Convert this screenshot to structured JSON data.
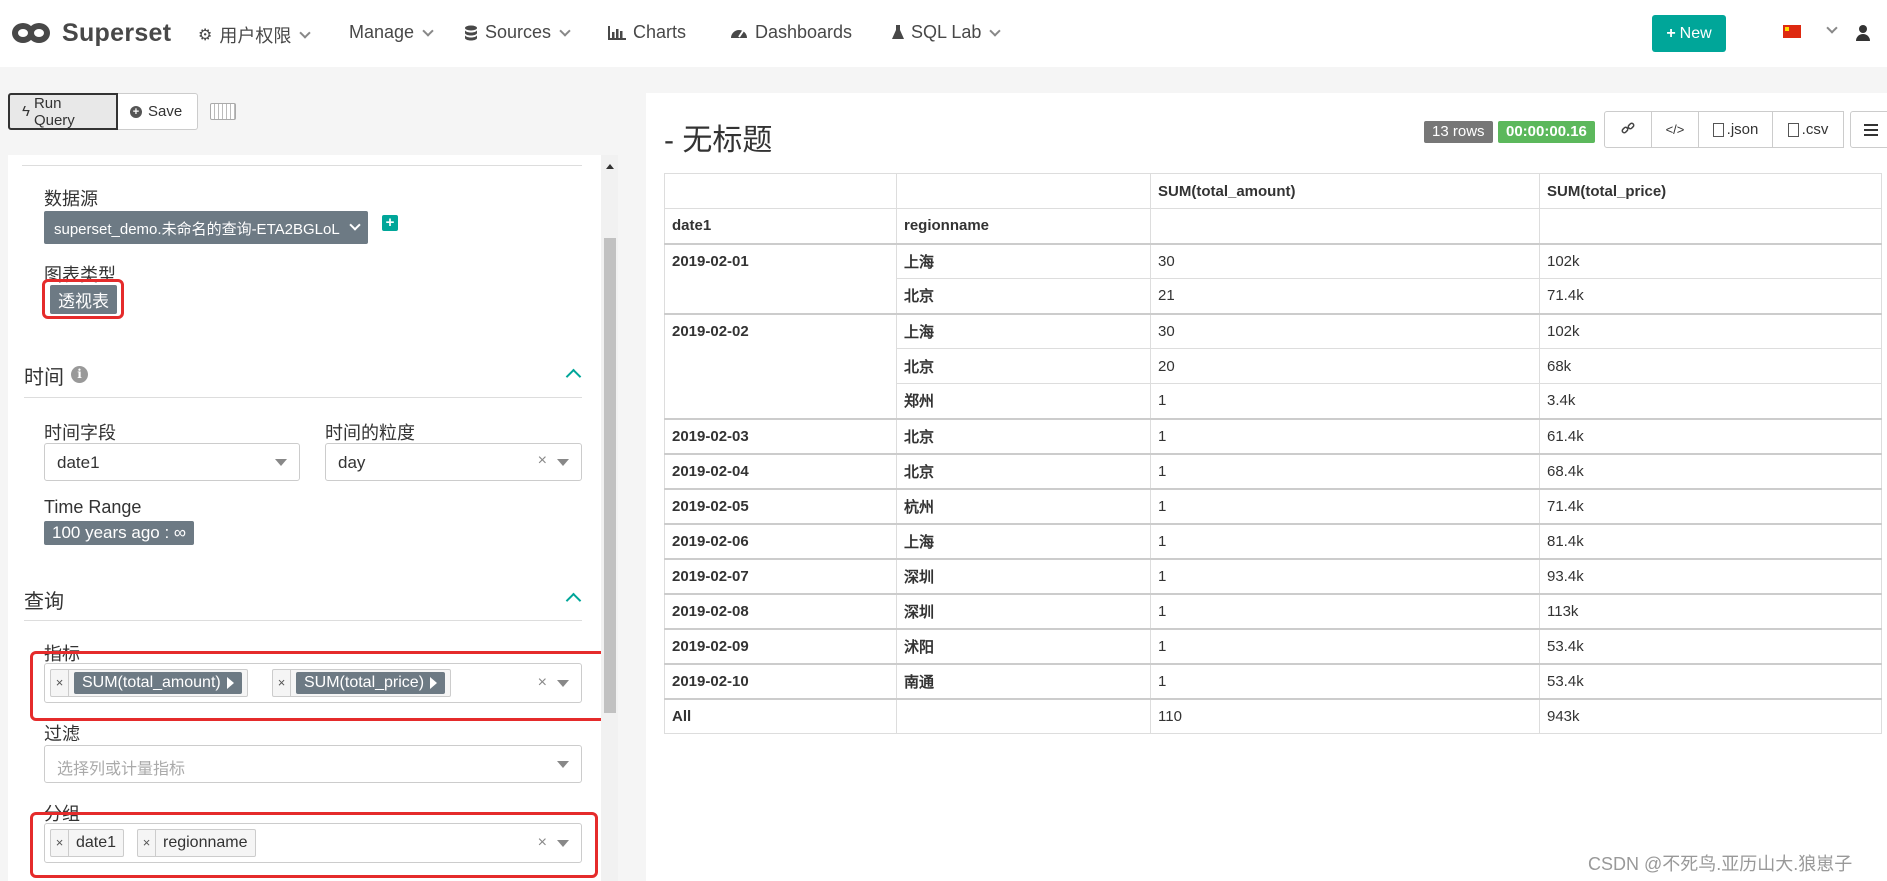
{
  "navbar": {
    "brand": "Superset",
    "items": [
      {
        "label": "用户权限",
        "icon": "gears-icon",
        "dropdown": true
      },
      {
        "label": "Manage",
        "icon": "",
        "dropdown": true
      },
      {
        "label": "Sources",
        "icon": "database-icon",
        "dropdown": true
      },
      {
        "label": "Charts",
        "icon": "bar-chart-icon",
        "dropdown": false
      },
      {
        "label": "Dashboards",
        "icon": "dashboard-icon",
        "dropdown": false
      },
      {
        "label": "SQL Lab",
        "icon": "flask-icon",
        "dropdown": true
      }
    ],
    "new_button": "New",
    "language_flag": "cn-flag-icon",
    "accent": "#00a699"
  },
  "toolbar": {
    "run_query": "Run Query",
    "save": "Save"
  },
  "datasource": {
    "label": "数据源",
    "value": "superset_demo.未命名的查询-ETA2BGLoL"
  },
  "chart_type": {
    "label": "图表类型",
    "value": "透视表"
  },
  "time_section": {
    "title": "时间",
    "time_column_label": "时间字段",
    "time_column_value": "date1",
    "time_grain_label": "时间的粒度",
    "time_grain_value": "day",
    "time_range_label": "Time Range",
    "time_range_value": "100 years ago : ∞"
  },
  "query_section": {
    "title": "查询",
    "metrics_label": "指标",
    "metrics": [
      "SUM(total_amount)",
      "SUM(total_price)"
    ],
    "filters_label": "过滤",
    "filters_placeholder": "选择列或计量指标",
    "groupby_label": "分组",
    "groupby": [
      "date1",
      "regionname"
    ]
  },
  "result": {
    "title": "- 无标题",
    "row_count": "13 rows",
    "duration": "00:00:00.16",
    "json_label": ".json",
    "csv_label": ".csv",
    "columns": [
      "date1",
      "regionname",
      "SUM(total_amount)",
      "SUM(total_price)"
    ],
    "groups": [
      {
        "date": "2019-02-01",
        "rows": [
          [
            "上海",
            "30",
            "102k"
          ],
          [
            "北京",
            "21",
            "71.4k"
          ]
        ]
      },
      {
        "date": "2019-02-02",
        "rows": [
          [
            "上海",
            "30",
            "102k"
          ],
          [
            "北京",
            "20",
            "68k"
          ],
          [
            "郑州",
            "1",
            "3.4k"
          ]
        ]
      },
      {
        "date": "2019-02-03",
        "rows": [
          [
            "北京",
            "1",
            "61.4k"
          ]
        ]
      },
      {
        "date": "2019-02-04",
        "rows": [
          [
            "北京",
            "1",
            "68.4k"
          ]
        ]
      },
      {
        "date": "2019-02-05",
        "rows": [
          [
            "杭州",
            "1",
            "71.4k"
          ]
        ]
      },
      {
        "date": "2019-02-06",
        "rows": [
          [
            "上海",
            "1",
            "81.4k"
          ]
        ]
      },
      {
        "date": "2019-02-07",
        "rows": [
          [
            "深圳",
            "1",
            "93.4k"
          ]
        ]
      },
      {
        "date": "2019-02-08",
        "rows": [
          [
            "深圳",
            "1",
            "113k"
          ]
        ]
      },
      {
        "date": "2019-02-09",
        "rows": [
          [
            "沭阳",
            "1",
            "53.4k"
          ]
        ]
      },
      {
        "date": "2019-02-10",
        "rows": [
          [
            "南通",
            "1",
            "53.4k"
          ]
        ]
      }
    ],
    "total": {
      "label": "All",
      "amount": "110",
      "price": "943k"
    }
  },
  "watermark": "CSDN @不死鸟.亚历山大.狼崽子"
}
